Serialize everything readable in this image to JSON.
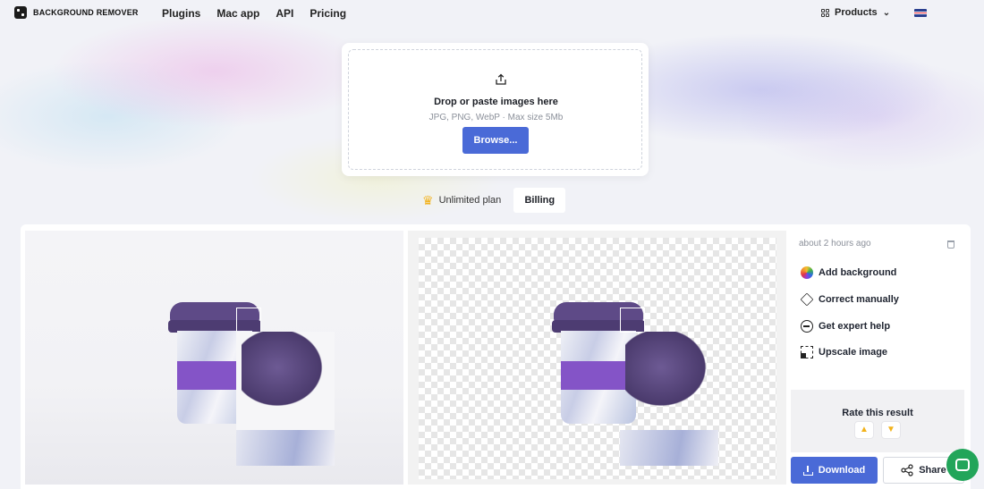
{
  "brand": {
    "name": "BACKGROUND REMOVER"
  },
  "nav": {
    "items": [
      "Plugins",
      "Mac app",
      "API",
      "Pricing"
    ]
  },
  "header": {
    "products_label": "Products"
  },
  "upload": {
    "title": "Drop or paste images here",
    "subtitle": "JPG, PNG, WebP · Max size 5Mb",
    "browse_label": "Browse..."
  },
  "plan": {
    "label": "Unlimited plan",
    "billing_label": "Billing"
  },
  "result": {
    "timestamp": "about 2 hours ago",
    "actions": [
      "Add background",
      "Correct manually",
      "Get expert help",
      "Upscale image"
    ],
    "rate_title": "Rate this result",
    "download_label": "Download",
    "share_label": "Share"
  },
  "icons": {
    "logo": "logo-icon",
    "products": "grid-icon",
    "upload": "upload-icon",
    "crown": "crown-icon",
    "delete": "trash-icon",
    "thumbs_up": "thumbs-up-icon",
    "thumbs_down": "thumbs-down-icon",
    "chat": "chat-icon"
  },
  "colors": {
    "accent": "#4a6ad7",
    "sleeve": "#8454c7",
    "lid": "#5e4a87",
    "chat": "#22a55a"
  }
}
